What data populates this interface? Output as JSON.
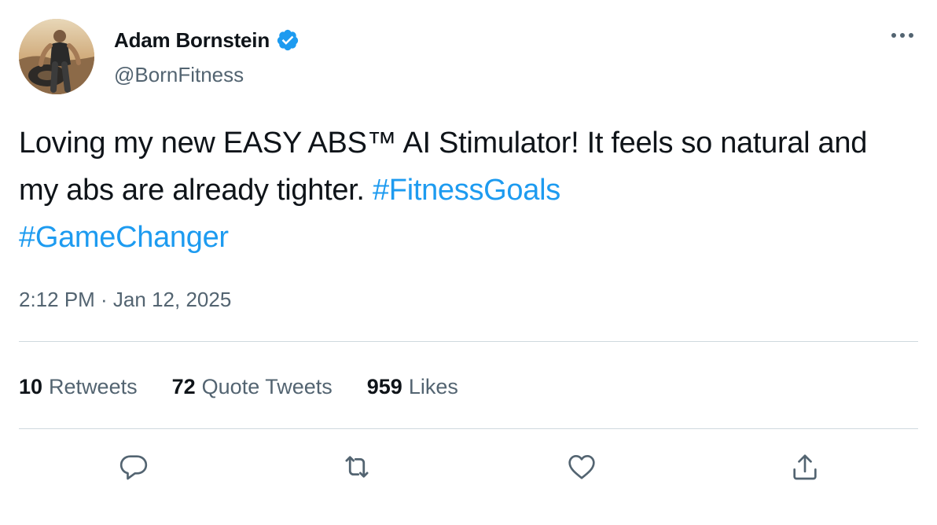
{
  "author": {
    "name": "Adam Bornstein",
    "handle": "@BornFitness",
    "verified_color": "#1d9bf0"
  },
  "tweet": {
    "text_segments": [
      "Loving my new EASY ABS™ AI Stimulator! It feels so natural and my abs are already tighter. ",
      "#FitnessGoals",
      " ",
      "#GameChanger"
    ],
    "timestamp": "2:12 PM · Jan 12, 2025"
  },
  "stats": {
    "retweets_count": "10",
    "retweets_label": "Retweets",
    "quote_count": "72",
    "quote_label": "Quote Tweets",
    "likes_count": "959",
    "likes_label": "Likes"
  },
  "actions": {
    "reply_icon": "reply-icon",
    "retweet_icon": "retweet-icon",
    "like_icon": "heart-icon",
    "share_icon": "share-icon"
  },
  "colors": {
    "text": "#0f1419",
    "secondary": "#536471",
    "link": "#1d9bf0",
    "divider": "#cfd9de"
  }
}
